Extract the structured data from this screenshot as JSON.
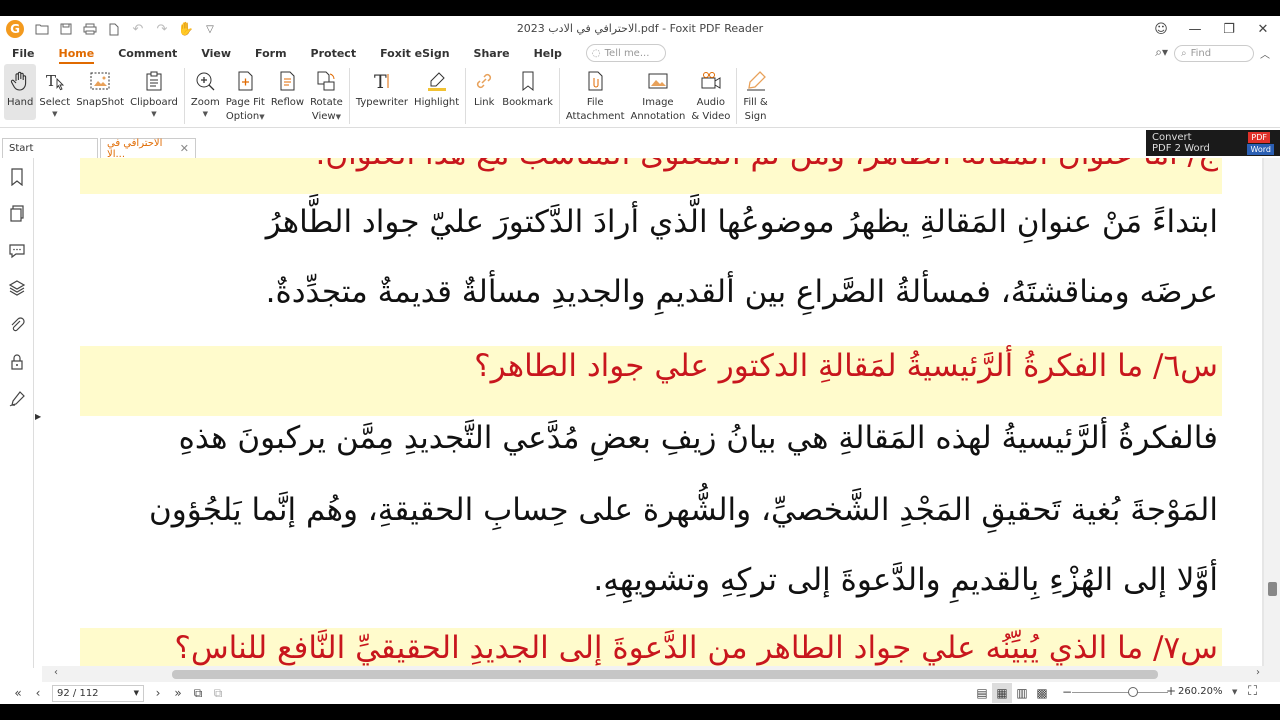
{
  "window": {
    "title": "الاحترافي في الادب 2023.pdf - Foxit PDF Reader"
  },
  "menu": {
    "items": [
      "File",
      "Home",
      "Comment",
      "View",
      "Form",
      "Protect",
      "Foxit eSign",
      "Share",
      "Help"
    ],
    "active": "Home",
    "tell_me_placeholder": "Tell me...",
    "find_placeholder": "Find"
  },
  "ribbon": {
    "hand": "Hand",
    "select": "Select",
    "snapshot": "SnapShot",
    "clipboard": "Clipboard",
    "zoom": "Zoom",
    "page_fit_1": "Page Fit",
    "page_fit_2": "Option",
    "reflow": "Reflow",
    "rotate_1": "Rotate",
    "rotate_2": "View",
    "typewriter": "Typewriter",
    "highlight": "Highlight",
    "link": "Link",
    "bookmark": "Bookmark",
    "file_1": "File",
    "file_2": "Attachment",
    "image_1": "Image",
    "image_2": "Annotation",
    "audio_1": "Audio",
    "audio_2": "& Video",
    "fill_1": "Fill &",
    "fill_2": "Sign"
  },
  "tabs": {
    "start": "Start",
    "doc": "الاحترافي في الا..."
  },
  "convert_banner": {
    "line1": "Convert",
    "line2": "PDF 2 Word",
    "pdf_badge": "PDF",
    "word_badge": "Word"
  },
  "document": {
    "top_partial": "ج/ أما عنوان المقالة الظاهر، ومن ثم المعنوى المناسب مع هذا العنوان.",
    "para1_line1": "ابتداءً مَنْ عنوانِ المَقالةِ يظهرُ موضوعُها الَّذي أرادَ الدَّكتورَ عليّ جواد الطَّاهرُ",
    "para1_line2": "عرضَه ومناقشتَهُ، فمسألةُ الصَّراعِ بين ألقديمِ والجديدِ مسألةٌ قديمةٌ متجدِّدةٌ.",
    "q6": "س٦/ ما الفكرةُ ألرَّئيسيةُ لمَقالةِ الدكتور علي جواد الطاهر؟",
    "para2_line1": "فالفكرةُ ألرَّئيسيةُ لهذه المَقالةِ هي بيانُ زيفِ بعضِ مُدَّعي التَّجديدِ مِمَّن يركبونَ هذهِ",
    "para2_line2": "المَوْجةَ بُغية تَحقيقِ المَجْدِ الشَّخصيِّ، والشُّهرة على حِسابِ الحقيقةِ، وهُم إنَّما يَلجُؤون",
    "para2_line3": "أوَّلا إلى الهُزْءِ بِالقديمِ والدَّعوةَ إلى تركِهِ وتشويهِهِ.",
    "q7": "س٧/ ما الذي يُبيِّنُه علي جواد الطاهر من الدَّعوةَ إلى الجديدِ الحقيقيِّ النَّافعِ للناسِ؟"
  },
  "status": {
    "page_indicator": "92 / 112",
    "zoom": "260.20%"
  },
  "colors": {
    "accent": "#e06a00",
    "question_red": "#c8161d",
    "highlight_yellow": "#fffbcc"
  }
}
